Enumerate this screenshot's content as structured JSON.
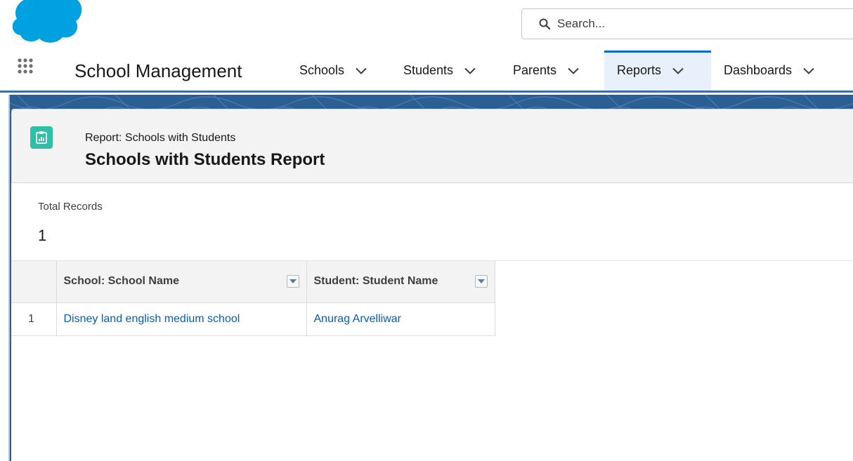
{
  "search": {
    "placeholder": "Search..."
  },
  "app": {
    "name": "School Management"
  },
  "nav": {
    "tabs": [
      {
        "label": "Schools"
      },
      {
        "label": "Students"
      },
      {
        "label": "Parents"
      },
      {
        "label": "Reports",
        "active": true
      },
      {
        "label": "Dashboards"
      }
    ]
  },
  "report": {
    "type_label": "Report: Schools with Students",
    "title": "Schools with Students Report",
    "total_records_label": "Total Records",
    "total_records_value": "1",
    "columns": [
      "School: School Name",
      "Student: Student Name"
    ],
    "rows": [
      {
        "num": "1",
        "school": "Disney land english medium school",
        "student": "Anurag Arvelliwar"
      }
    ]
  },
  "colors": {
    "brand_blue": "#1b74d3",
    "logo_blue": "#00a1e0",
    "report_icon_teal": "#2ebfa5",
    "link_blue": "#0b5cab",
    "active_tab_bg": "#e8f0fb"
  },
  "icons": {
    "logo": "salesforce-cloud-icon",
    "search": "search-icon",
    "launcher": "app-launcher-grid-icon",
    "tab_menu": "chevron-down-icon",
    "report": "report-icon",
    "column_menu": "dropdown-arrow-icon"
  }
}
